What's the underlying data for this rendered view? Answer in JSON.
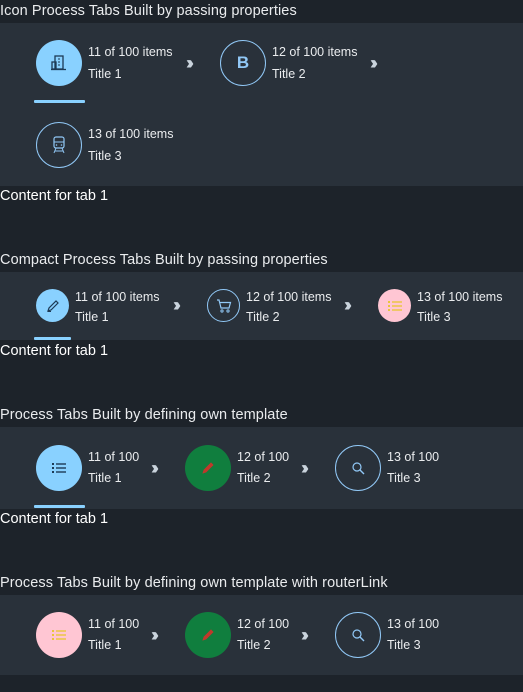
{
  "section1": {
    "title": "Icon Process Tabs Built by passing properties",
    "tabs": [
      {
        "count": "11 of 100 items",
        "title": "Title 1",
        "icon": "building-icon"
      },
      {
        "count": "12 of 100 items",
        "title": "Title 2",
        "letter": "B"
      },
      {
        "count": "13 of 100 items",
        "title": "Title 3",
        "icon": "train-icon"
      }
    ],
    "content": "Content for tab 1"
  },
  "section2": {
    "title": "Compact Process Tabs Built by passing properties",
    "tabs": [
      {
        "count": "11 of 100 items",
        "title": "Title 1",
        "icon": "pencil-icon"
      },
      {
        "count": "12 of 100 items",
        "title": "Title 2",
        "icon": "cart-icon"
      },
      {
        "count": "13 of 100 items",
        "title": "Title 3",
        "icon": "list-icon"
      }
    ],
    "content": "Content for tab 1"
  },
  "section3": {
    "title": "Process Tabs Built by defining own template",
    "tabs": [
      {
        "count": "11 of 100",
        "title": "Title 1",
        "icon": "list-icon"
      },
      {
        "count": "12 of 100",
        "title": "Title 2",
        "icon": "pencil-icon"
      },
      {
        "count": "13 of 100",
        "title": "Title 3",
        "icon": "search-icon"
      }
    ],
    "content": "Content for tab 1"
  },
  "section4": {
    "title": "Process Tabs Built by defining own template with routerLink",
    "tabs": [
      {
        "count": "11 of 100",
        "title": "Title 1",
        "icon": "list-icon"
      },
      {
        "count": "12 of 100",
        "title": "Title 2",
        "icon": "pencil-icon"
      },
      {
        "count": "13 of 100",
        "title": "Title 3",
        "icon": "search-icon"
      }
    ]
  },
  "colors": {
    "page_bg": "#1d232a",
    "bar_bg": "#29313a",
    "active_blue": "#89d1ff",
    "outline_blue": "#91c8f6",
    "green": "#107e3e",
    "pink": "#ffc6d3"
  }
}
